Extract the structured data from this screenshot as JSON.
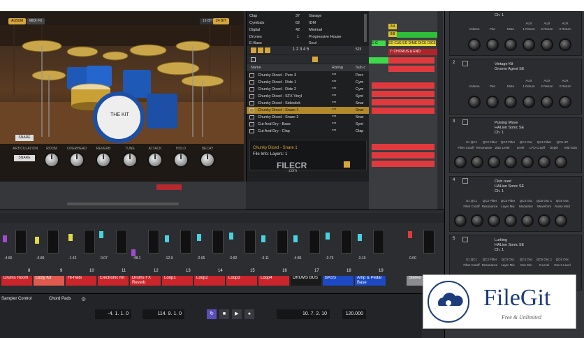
{
  "drum": {
    "tabs": [
      "ALBUM",
      "MIDI FX"
    ],
    "bitrate": [
      "16 BIT",
      "24 BIT"
    ],
    "kit_name": "THE KIT",
    "snare_label": "SNARE",
    "articulation_label": "ARTICULATION",
    "articulation_value": "SNARE",
    "knobs": [
      "ROOM",
      "OVERHEAD",
      "REVERB",
      "TUNE",
      "ATTACK",
      "HOLD",
      "DECAY"
    ]
  },
  "browser": {
    "categories_left": [
      {
        "name": "Clap",
        "count": "37"
      },
      {
        "name": "Cymbals",
        "count": "62"
      },
      {
        "name": "Digital",
        "count": "42"
      },
      {
        "name": "Drones",
        "count": "1"
      },
      {
        "name": "E-Bass",
        "count": "2"
      }
    ],
    "categories_right": [
      "Garage",
      "IDM",
      "Minimal",
      "Progressive House",
      "Soul"
    ],
    "page_numbers": "1 2 3 4 5",
    "result_count": "523",
    "columns": {
      "name": "Name",
      "rating": "Rating",
      "sub": "Sub c"
    },
    "rows": [
      {
        "name": "Chunky Diced - Perc 3",
        "rating": "***",
        "sub": "Perc"
      },
      {
        "name": "Chunky Diced - Ride 1",
        "rating": "***",
        "sub": "Cym"
      },
      {
        "name": "Chunky Diced - Ride 2",
        "rating": "***",
        "sub": "Cym"
      },
      {
        "name": "Chunky Diced - SFX Vinyl",
        "rating": "***",
        "sub": "Synt"
      },
      {
        "name": "Chunky Diced - Sidestick",
        "rating": "***",
        "sub": "Snar"
      },
      {
        "name": "Chunky Diced - Snare 1",
        "rating": "***",
        "sub": "Snar"
      },
      {
        "name": "Chunky Diced - Snare 2",
        "rating": "***",
        "sub": "Snar"
      },
      {
        "name": "Cut And Dry - Bass",
        "rating": "***",
        "sub": "Synt"
      },
      {
        "name": "Cut And Dry - Clap",
        "rating": "***",
        "sub": "Clap"
      }
    ],
    "info_title": "Chunky Diced - Snare 1",
    "info_layers": "File Info: Layers: 1"
  },
  "arrangement": {
    "markers": [
      "2/4",
      "9/8"
    ],
    "clip_labels": [
      "E-G",
      "ED CUE ED DIME DICE DICE",
      "7: CHORUS & END"
    ]
  },
  "rack": {
    "header_labels": [
      "AUX",
      "AUX",
      "AUX"
    ],
    "header_params": [
      "Volume",
      "Pan",
      "Mute",
      "1 Return",
      "2 Return",
      "3 Return"
    ],
    "slots": [
      {
        "num": "",
        "name": "",
        "sub": "Ch. 1",
        "params": [
          "Volume",
          "Pan",
          "Mute",
          "1 Return",
          "2 Return",
          "3 Return"
        ],
        "aux": [
          "AUX",
          "AUX",
          "AUX"
        ]
      },
      {
        "num": "2",
        "name": "Vintage Kit",
        "sub": "Groove Agent SE",
        "params": [
          "Volume",
          "Pan",
          "Mute",
          "1 Return",
          "2 Return",
          "3 Return"
        ],
        "aux": [
          "AUX",
          "AUX",
          "AUX"
        ]
      },
      {
        "num": "3",
        "name": "Pulsing Wave",
        "sub": "HALion Sonic SE",
        "extra": "Ch. 1",
        "params": [
          "S1 QC1",
          "QC2 Filter",
          "QC3 Filter",
          "QC4 Osc",
          "QC5 Filter",
          "QC6 HP"
        ],
        "params2": [
          "Filter Cutoff",
          "Resonance",
          "Z&S Level",
          "Level",
          "LFO Cutoff",
          "Depth",
          "Mid Gain"
        ]
      },
      {
        "num": "4",
        "name": "Club read",
        "sub": "HALion Sonic SE",
        "extra": "Ch. 1",
        "params": [
          "S1 QC1",
          "QC2 Filter",
          "QC3 Filter",
          "QC4 Osc",
          "QC5 Osc 1",
          "QC6 Osc"
        ],
        "params2": [
          "Filter Cutoff",
          "Resonance",
          "Layer Mix",
          "Modulator",
          "Waveform",
          "Noise Mod"
        ]
      },
      {
        "num": "5",
        "name": "Lurking",
        "sub": "HALion Sonic SE",
        "extra": "Ch. 1",
        "params": [
          "S1 QC1",
          "QC2 Filter",
          "QC3 Osc",
          "QC4 Osc",
          "QC5 Osc 1",
          "QC6 Osc"
        ],
        "params2": [
          "Filter Cutoff",
          "Resonance",
          "Layer Mix",
          "Osc Mix",
          "2 Level",
          "Osc 3 Level"
        ]
      }
    ]
  },
  "mixer": {
    "values": [
      "-4.66",
      "-6.89",
      "-1.42",
      "0.07",
      "-48.1",
      "-12.9",
      "-2.65",
      "-0.82",
      "-6.11",
      "-4.86",
      "-0.76",
      "-3.19",
      "0.00"
    ],
    "channel_numbers": [
      "8",
      "9",
      "10",
      "11",
      "12",
      "13",
      "14",
      "15",
      "16",
      "17",
      "18",
      "19"
    ],
    "tracks": [
      {
        "name": "Drums Room",
        "color": "#c9252b"
      },
      {
        "name": "Ozzy Kit",
        "color": "#e05a4e"
      },
      {
        "name": "Hi-Hats",
        "color": "#c9252b"
      },
      {
        "name": "Electronic Kit",
        "color": "#c9252b"
      },
      {
        "name": "Drums FX Reverb",
        "color": "#c9252b"
      },
      {
        "name": "Loop1",
        "color": "#c9252b"
      },
      {
        "name": "Loop2",
        "color": "#c9252b"
      },
      {
        "name": "Loop3",
        "color": "#c9252b"
      },
      {
        "name": "Loop4",
        "color": "#c9252b"
      },
      {
        "name": "DRUMS BUS",
        "color": "#1a1a1a"
      },
      {
        "name": "BASS",
        "color": "#1d49c4"
      },
      {
        "name": "Amp & Pedal Base",
        "color": "#1d49c4"
      },
      {
        "name": "Stereo",
        "color": "#8a8c90"
      }
    ]
  },
  "transport": {
    "tabs": [
      "Sampler Control",
      "Chord Pads"
    ],
    "left_locator": "-4. 1. 1.   0",
    "right_locator": "114. 9. 1.   0",
    "position": "10. 7. 2. 10",
    "tempo": "120.000"
  },
  "watermark": {
    "name": "FileGit",
    "tagline": "Free & Unlimited",
    "overlay": "FILECR",
    "overlay_sub": ".com"
  },
  "colors": {
    "accent_red": "#e03a3e",
    "accent_blue": "#1d49c4",
    "select_gold": "#b28a2c",
    "transport_purple": "#5a4fb8"
  }
}
